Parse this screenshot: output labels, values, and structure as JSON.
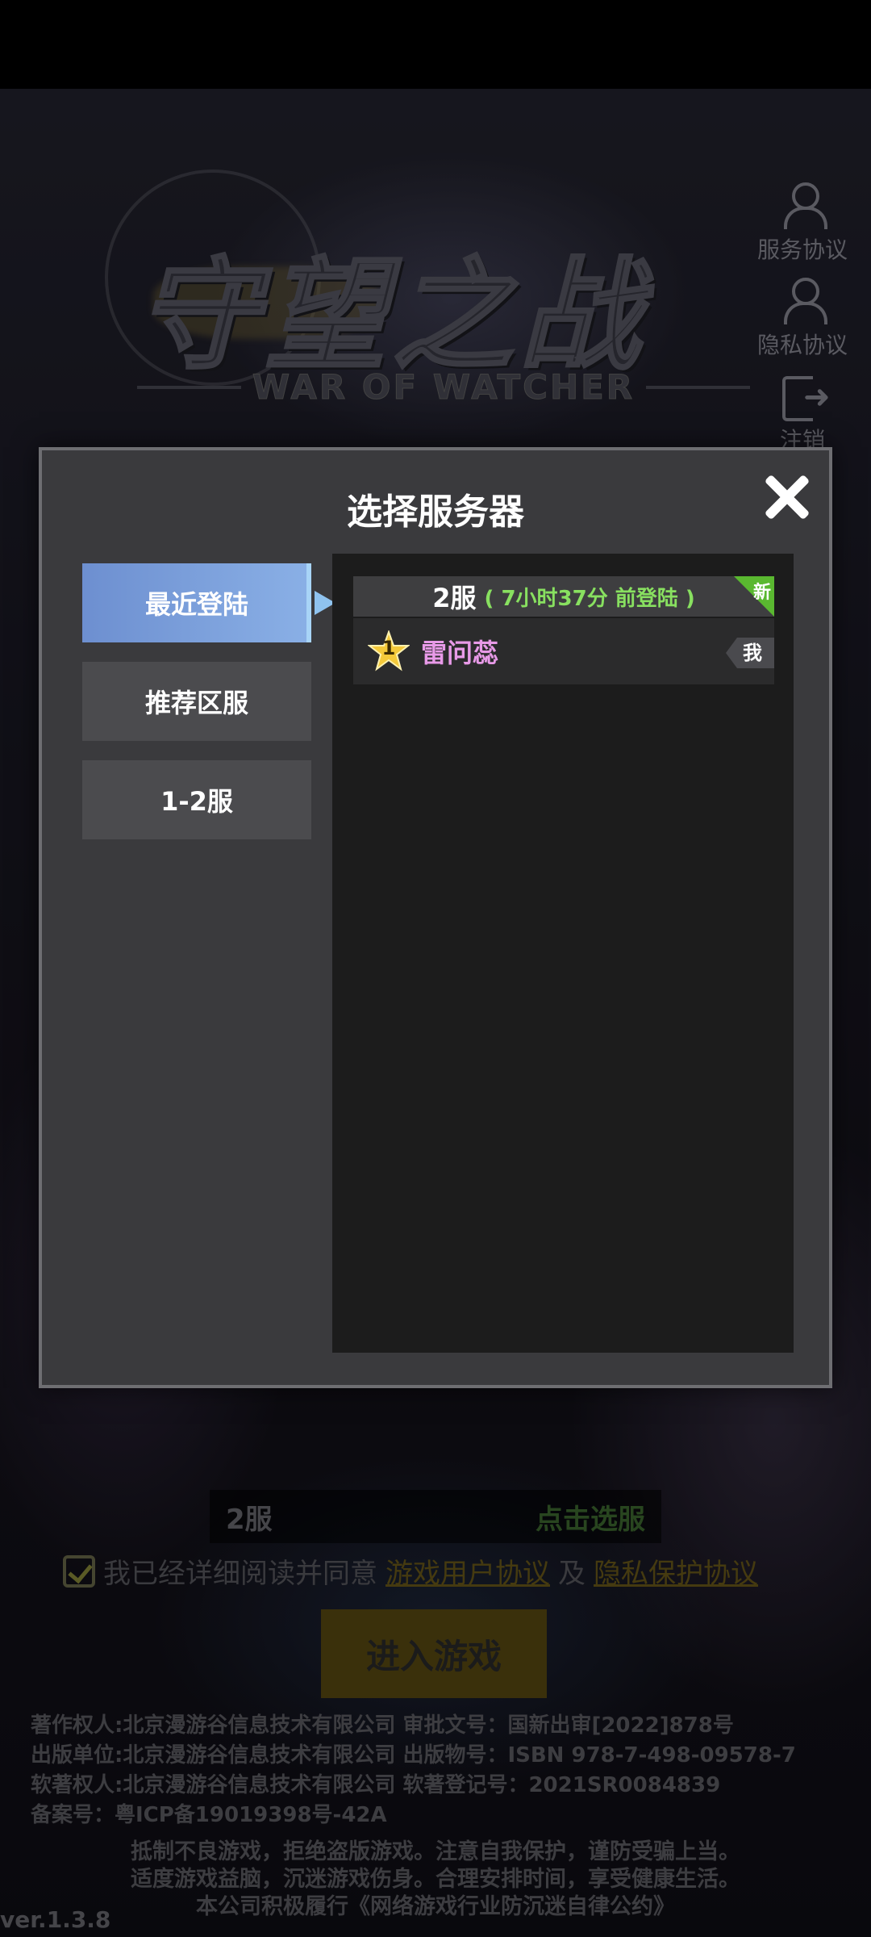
{
  "logo": {
    "title": "守望之战",
    "subtitle": "WAR OF WATCHER"
  },
  "side_menu": {
    "service": "服务协议",
    "privacy": "隐私协议",
    "logout": "注销"
  },
  "modal": {
    "title": "选择服务器",
    "tabs": [
      "最近登陆",
      "推荐区服",
      "1-2服"
    ],
    "active_tab": "最近登陆",
    "server": {
      "name": "2服",
      "last_login": "( 7小时37分 前登陆 )",
      "badge": "新",
      "character": {
        "rank": "1",
        "name": "雷问蕊",
        "tag": "我"
      }
    }
  },
  "bottom": {
    "current_server": "2服",
    "pick_server": "点击选服",
    "agree_text": "我已经详细阅读并同意",
    "user_agreement": "游戏用户协议",
    "and": "及",
    "privacy_agreement": "隐私保护协议",
    "enter_button": "进入游戏"
  },
  "legal": {
    "lines": [
      "著作权人:北京漫游谷信息技术有限公司  审批文号：国新出审[2022]878号",
      "出版单位:北京漫游谷信息技术有限公司  出版物号：ISBN 978-7-498-09578-7",
      "软著权人:北京漫游谷信息技术有限公司  软著登记号：2021SR0084839",
      "备案号：粤ICP备19019398号-42A"
    ],
    "notice": [
      "抵制不良游戏，拒绝盗版游戏。注意自我保护，谨防受骗上当。",
      "适度游戏益脑，沉迷游戏伤身。合理安排时间，享受健康生活。",
      "本公司积极履行《网络游戏行业防沉迷自律公约》"
    ],
    "version": "ver.1.3.8"
  },
  "colors": {
    "active_tab": "#8ab0e6",
    "new_badge": "#5ab830",
    "last_login": "#88e060",
    "char_name": "#e89ae8"
  }
}
